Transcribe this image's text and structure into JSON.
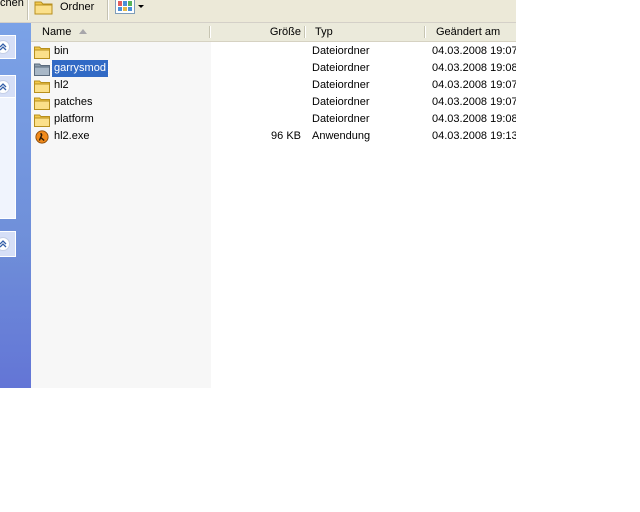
{
  "toolbar": {
    "search_label": "chen",
    "folders_label": "Ordner"
  },
  "columns": {
    "name": "Name",
    "size": "Größe",
    "type": "Typ",
    "modified": "Geändert am"
  },
  "files": [
    {
      "name": "bin",
      "size": "",
      "type": "Dateiordner",
      "modified": "04.03.2008 19:07",
      "icon": "folder-icon"
    },
    {
      "name": "garrysmod",
      "size": "",
      "type": "Dateiordner",
      "modified": "04.03.2008 19:08",
      "icon": "folder-icon",
      "selected": true
    },
    {
      "name": "hl2",
      "size": "",
      "type": "Dateiordner",
      "modified": "04.03.2008 19:07",
      "icon": "folder-icon"
    },
    {
      "name": "patches",
      "size": "",
      "type": "Dateiordner",
      "modified": "04.03.2008 19:07",
      "icon": "folder-icon"
    },
    {
      "name": "platform",
      "size": "",
      "type": "Dateiordner",
      "modified": "04.03.2008 19:08",
      "icon": "folder-icon"
    },
    {
      "name": "hl2.exe",
      "size": "96 KB",
      "type": "Anwendung",
      "modified": "04.03.2008 19:13",
      "icon": "half-life-icon"
    }
  ],
  "colors": {
    "selection": "#316ac5",
    "taskpane": "#6f8fd9"
  }
}
